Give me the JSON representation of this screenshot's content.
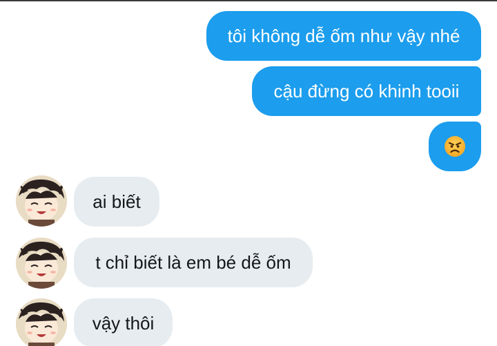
{
  "conversation": {
    "messages": [
      {
        "direction": "outgoing",
        "text": "tôi không dễ ốm như vậy nhé"
      },
      {
        "direction": "outgoing",
        "text": "cậu đừng có khinh tooii"
      },
      {
        "direction": "outgoing",
        "emoji": "angry-face-icon"
      },
      {
        "direction": "incoming",
        "text": "ai biết"
      },
      {
        "direction": "incoming",
        "text": "t chỉ biết là em bé dễ ốm"
      },
      {
        "direction": "incoming",
        "text": "vậy thôi"
      }
    ]
  },
  "colors": {
    "outgoing_bubble": "#1c9ded",
    "incoming_bubble": "#e6ecf0",
    "outgoing_text": "#ffffff",
    "incoming_text": "#14171a"
  }
}
